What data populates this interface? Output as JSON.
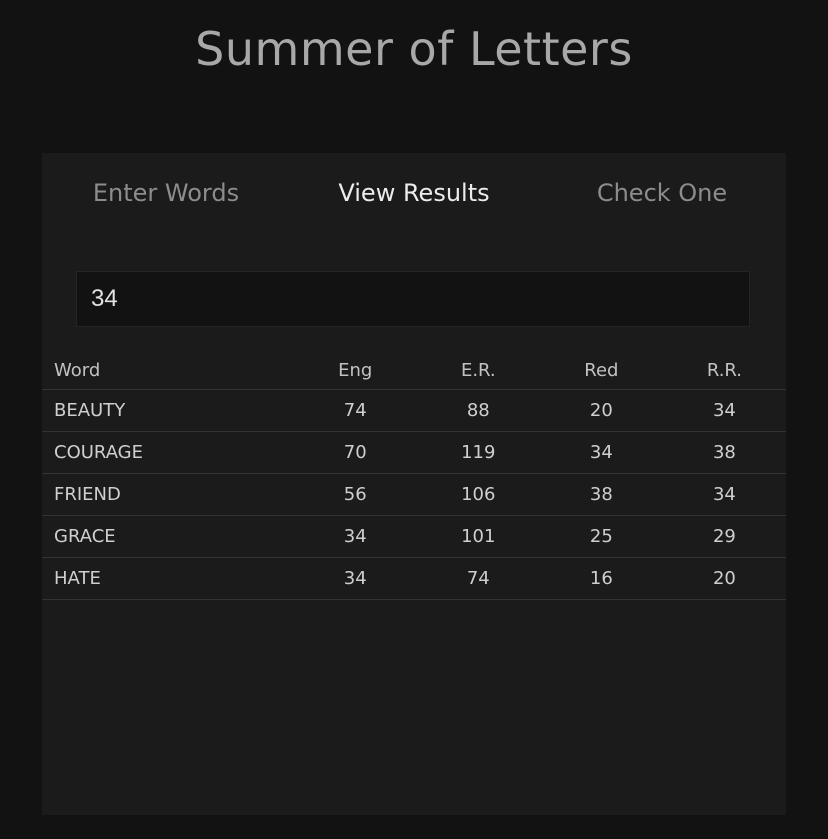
{
  "app": {
    "title": "Summer of Letters"
  },
  "tabs": [
    {
      "label": "Enter Words",
      "active": false
    },
    {
      "label": "View Results",
      "active": true
    },
    {
      "label": "Check One",
      "active": false
    }
  ],
  "filter": {
    "value": "34"
  },
  "table": {
    "columns": [
      "Word",
      "Eng",
      "E.R.",
      "Red",
      "R.R."
    ],
    "rows": [
      [
        "BEAUTY",
        "74",
        "88",
        "20",
        "34"
      ],
      [
        "COURAGE",
        "70",
        "119",
        "34",
        "38"
      ],
      [
        "FRIEND",
        "56",
        "106",
        "38",
        "34"
      ],
      [
        "GRACE",
        "34",
        "101",
        "25",
        "29"
      ],
      [
        "HATE",
        "34",
        "74",
        "16",
        "20"
      ]
    ]
  },
  "colors": {
    "background": "#121212",
    "panel": "#1b1b1b",
    "active_tab": "#ececec",
    "inactive_tab": "#8c8c8c"
  }
}
